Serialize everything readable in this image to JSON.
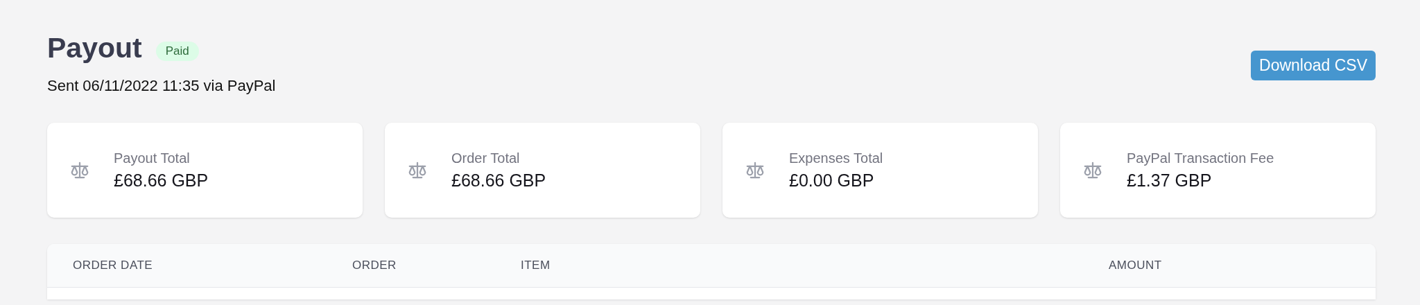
{
  "header": {
    "title": "Payout",
    "status": "Paid",
    "subtitle": "Sent 06/11/2022 11:35 via PayPal",
    "button": "Download CSV"
  },
  "stats": [
    {
      "label": "Payout Total",
      "value": "£68.66 GBP"
    },
    {
      "label": "Order Total",
      "value": "£68.66 GBP"
    },
    {
      "label": "Expenses Total",
      "value": "£0.00 GBP"
    },
    {
      "label": "PayPal Transaction Fee",
      "value": "£1.37 GBP"
    }
  ],
  "table": {
    "columns": [
      "ORDER DATE",
      "ORDER",
      "ITEM",
      "AMOUNT"
    ]
  }
}
